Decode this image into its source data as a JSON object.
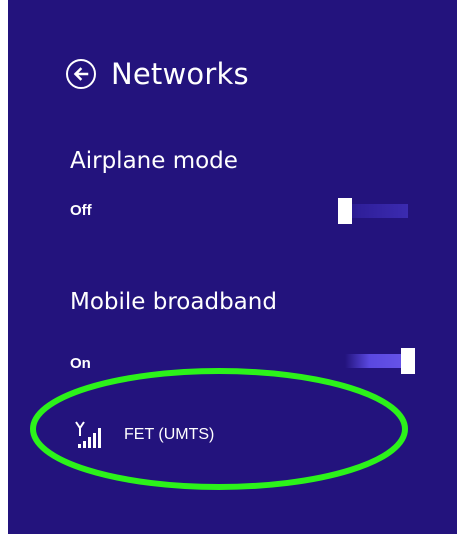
{
  "header": {
    "title": "Networks"
  },
  "airplane_mode": {
    "label": "Airplane mode",
    "state": "Off"
  },
  "mobile_broadband": {
    "label": "Mobile broadband",
    "state": "On"
  },
  "network": {
    "name": "FET (UMTS)",
    "icon": "cellular-signal-icon"
  },
  "colors": {
    "background": "#23137d",
    "highlight": "#2cf21a",
    "text": "#ffffff"
  }
}
